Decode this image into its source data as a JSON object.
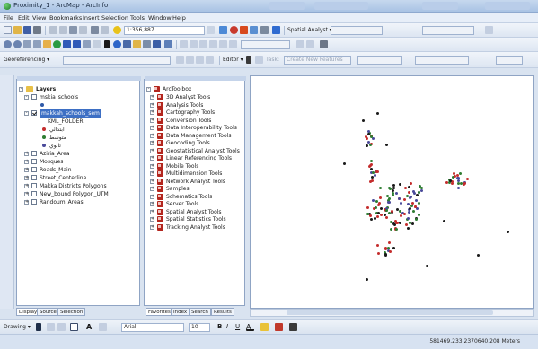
{
  "window": {
    "title": "Proximity_1 - ArcMap - ArcInfo"
  },
  "menu": [
    "File",
    "Edit",
    "View",
    "Bookmarks",
    "Insert",
    "Selection",
    "Tools",
    "Window",
    "Help"
  ],
  "toolbar1": {
    "scale": "1:356,887",
    "spatial_analyst": "Spatial Analyst ▾"
  },
  "toolbar2": {
    "georeferencing": "Georeferencing ▾"
  },
  "toolbar3": {
    "editor": "Editor ▾",
    "create_features": "Create New Features"
  },
  "toc": {
    "root": "Layers",
    "layers": [
      {
        "name": "mskia_schools",
        "checked": false,
        "expanded": true,
        "children": []
      },
      {
        "name": "makkah_schools_sem",
        "checked": true,
        "expanded": true,
        "selected": true,
        "field": "KML_FOLDER",
        "classes": [
          {
            "label": "ابتدائي",
            "color": "#c42d2d"
          },
          {
            "label": "متوسط",
            "color": "#2e7d32"
          },
          {
            "label": "ثانوي",
            "color": "#4a4a9a"
          }
        ]
      },
      {
        "name": "Aziria_Area",
        "checked": false
      },
      {
        "name": "Mosques",
        "checked": false
      },
      {
        "name": "Roads_Main",
        "checked": false
      },
      {
        "name": "Street_Centerline",
        "checked": false
      },
      {
        "name": "Makka Districts Polygons",
        "checked": false
      },
      {
        "name": "New_bound Polygon_UTM",
        "checked": false
      },
      {
        "name": "Randoum_Areas",
        "checked": false
      }
    ]
  },
  "toc_tabs": [
    "Display",
    "Source",
    "Selection"
  ],
  "toolbox": {
    "root": "ArcToolbox",
    "items": [
      "3D Analyst Tools",
      "Analysis Tools",
      "Cartography Tools",
      "Conversion Tools",
      "Data Interoperability Tools",
      "Data Management Tools",
      "Geocoding Tools",
      "Geostatistical Analyst Tools",
      "Linear Referencing Tools",
      "Mobile Tools",
      "Multidimension Tools",
      "Network Analyst Tools",
      "Samples",
      "Schematics Tools",
      "Server Tools",
      "Spatial Analyst Tools",
      "Spatial Statistics Tools",
      "Tracking Analyst Tools"
    ]
  },
  "toolbox_tabs": [
    "Favorites",
    "Index",
    "Search",
    "Results"
  ],
  "drawing": {
    "label": "Drawing ▾",
    "font": "Arial",
    "size": "10"
  },
  "status": {
    "coordinates": "581469.233  2370640.208 Meters"
  }
}
